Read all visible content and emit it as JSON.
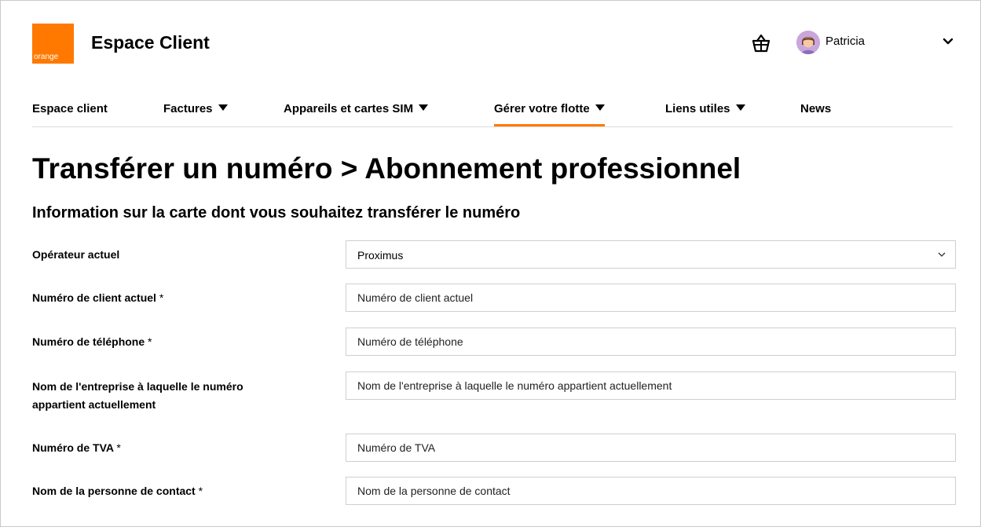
{
  "brand": {
    "logo_text": "orange",
    "app_title": "Espace Client",
    "color": "#ff7900"
  },
  "header": {
    "basket_icon": "shopping-basket-icon",
    "user_name": "Patricia"
  },
  "nav": {
    "items": [
      {
        "label": "Espace client",
        "has_dropdown": false,
        "active": false
      },
      {
        "label": "Factures",
        "has_dropdown": true,
        "active": false
      },
      {
        "label": "Appareils et cartes SIM",
        "has_dropdown": true,
        "active": false
      },
      {
        "label": "Gérer votre flotte",
        "has_dropdown": true,
        "active": true
      },
      {
        "label": "Liens utiles",
        "has_dropdown": true,
        "active": false
      },
      {
        "label": "News",
        "has_dropdown": false,
        "active": false
      }
    ]
  },
  "page": {
    "title": "Transférer un numéro > Abonnement professionnel",
    "section_title": "Information sur la carte dont vous souhaitez transférer le numéro"
  },
  "form": {
    "operator": {
      "label": "Opérateur actuel",
      "selected": "Proximus"
    },
    "client_number": {
      "label": "Numéro de client actuel",
      "required": "*",
      "placeholder": "Numéro de client actuel"
    },
    "phone": {
      "label": "Numéro de téléphone",
      "required": "*",
      "placeholder": "Numéro de téléphone"
    },
    "company": {
      "label": "Nom de l'entreprise à laquelle le numéro appartient actuellement",
      "placeholder": "Nom de l'entreprise à laquelle le numéro appartient actuellement"
    },
    "vat": {
      "label": "Numéro de TVA",
      "required": "*",
      "placeholder": "Numéro de TVA"
    },
    "contact": {
      "label": "Nom de la personne de contact",
      "required": "*",
      "placeholder": "Nom de la personne de contact"
    }
  }
}
